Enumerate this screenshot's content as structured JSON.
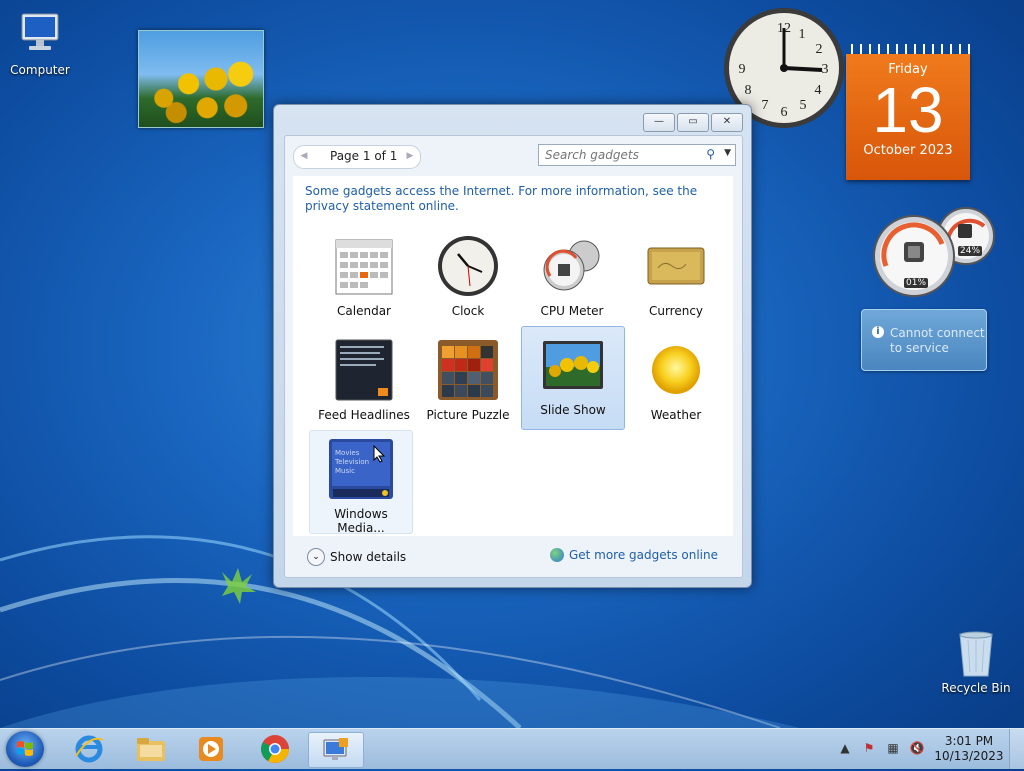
{
  "desktop": {
    "computer_label": "Computer",
    "recycle_label": "Recycle Bin"
  },
  "calendar_gadget": {
    "day": "Friday",
    "date": "13",
    "month_year": "October 2023"
  },
  "cpu_gadget": {
    "cpu": "01%",
    "memory": "24%"
  },
  "notice_gadget": {
    "icon": "i",
    "text": "Cannot connect to service"
  },
  "window": {
    "buttons": {
      "minimize": "—",
      "restore": "▭",
      "close": "✕"
    },
    "pager": {
      "prev": "◀",
      "next": "▶",
      "text": "Page 1 of 1"
    },
    "search": {
      "placeholder": "Search gadgets",
      "icon": "⚲",
      "dropdown": "▼"
    },
    "notice": "Some gadgets access the Internet.  For more information, see the privacy statement online.",
    "gadgets": [
      {
        "name": "Calendar"
      },
      {
        "name": "Clock"
      },
      {
        "name": "CPU Meter"
      },
      {
        "name": "Currency"
      },
      {
        "name": "Feed Headlines"
      },
      {
        "name": "Picture Puzzle"
      },
      {
        "name": "Slide Show",
        "selected": true
      },
      {
        "name": "Weather"
      },
      {
        "name": "Windows Media..."
      }
    ],
    "media_items": [
      "Movies",
      "Television",
      "Music"
    ],
    "show_details": "Show details",
    "show_details_icon": "⌄",
    "get_more": "Get more gadgets online"
  },
  "taskbar": {
    "apps": [
      "internet-explorer",
      "file-explorer",
      "windows-media-player",
      "google-chrome",
      "desktop-gadgets"
    ],
    "tray_icons": {
      "arrow": "▲",
      "flag": "⚑",
      "network": "▦",
      "volume": "🔇"
    },
    "time": "3:01 PM",
    "date": "10/13/2023"
  },
  "colors": {
    "accent": "#1f5fa8",
    "calendar": "#e8680f"
  }
}
